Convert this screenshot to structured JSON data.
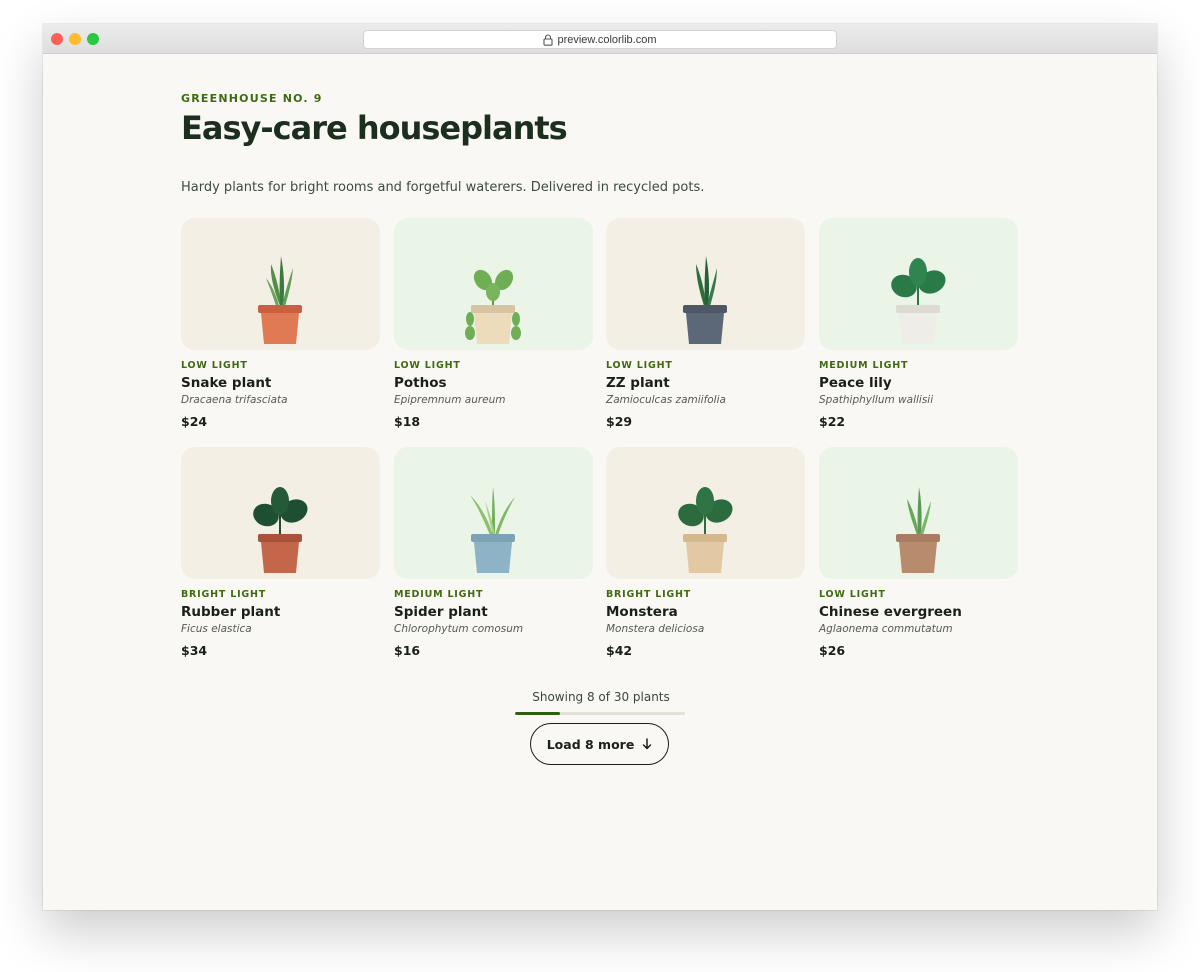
{
  "browser": {
    "url": "preview.colorlib.com"
  },
  "header": {
    "eyebrow": "GREENHOUSE NO. 9",
    "title": "Easy-care houseplants",
    "subtitle": "Hardy plants for bright rooms and forgetful waterers. Delivered in recycled pots."
  },
  "products": [
    {
      "light": "LOW LIGHT",
      "name": "Snake plant",
      "latin": "Dracaena trifasciata",
      "price": "$24",
      "icon": "snake-plant-icon"
    },
    {
      "light": "LOW LIGHT",
      "name": "Pothos",
      "latin": "Epipremnum aureum",
      "price": "$18",
      "icon": "pothos-icon"
    },
    {
      "light": "LOW LIGHT",
      "name": "ZZ plant",
      "latin": "Zamioculcas zamiifolia",
      "price": "$29",
      "icon": "zz-plant-icon"
    },
    {
      "light": "MEDIUM LIGHT",
      "name": "Peace lily",
      "latin": "Spathiphyllum wallisii",
      "price": "$22",
      "icon": "peace-lily-icon"
    },
    {
      "light": "BRIGHT LIGHT",
      "name": "Rubber plant",
      "latin": "Ficus elastica",
      "price": "$34",
      "icon": "rubber-plant-icon"
    },
    {
      "light": "MEDIUM LIGHT",
      "name": "Spider plant",
      "latin": "Chlorophytum comosum",
      "price": "$16",
      "icon": "spider-plant-icon"
    },
    {
      "light": "BRIGHT LIGHT",
      "name": "Monstera",
      "latin": "Monstera deliciosa",
      "price": "$42",
      "icon": "monstera-icon"
    },
    {
      "light": "LOW LIGHT",
      "name": "Chinese evergreen",
      "latin": "Aglaonema commutatum",
      "price": "$26",
      "icon": "chinese-evergreen-icon"
    }
  ],
  "pagination": {
    "showing_text": "Showing 8 of 30 plants",
    "shown": 8,
    "total": 30,
    "load_more_label": "Load 8 more"
  },
  "colors": {
    "accent": "#3f6a12",
    "progress": "#2e5e0e",
    "card_beige": "#f3efe4",
    "card_mint": "#eaf4e7",
    "text_dark": "#1c2e1e"
  }
}
